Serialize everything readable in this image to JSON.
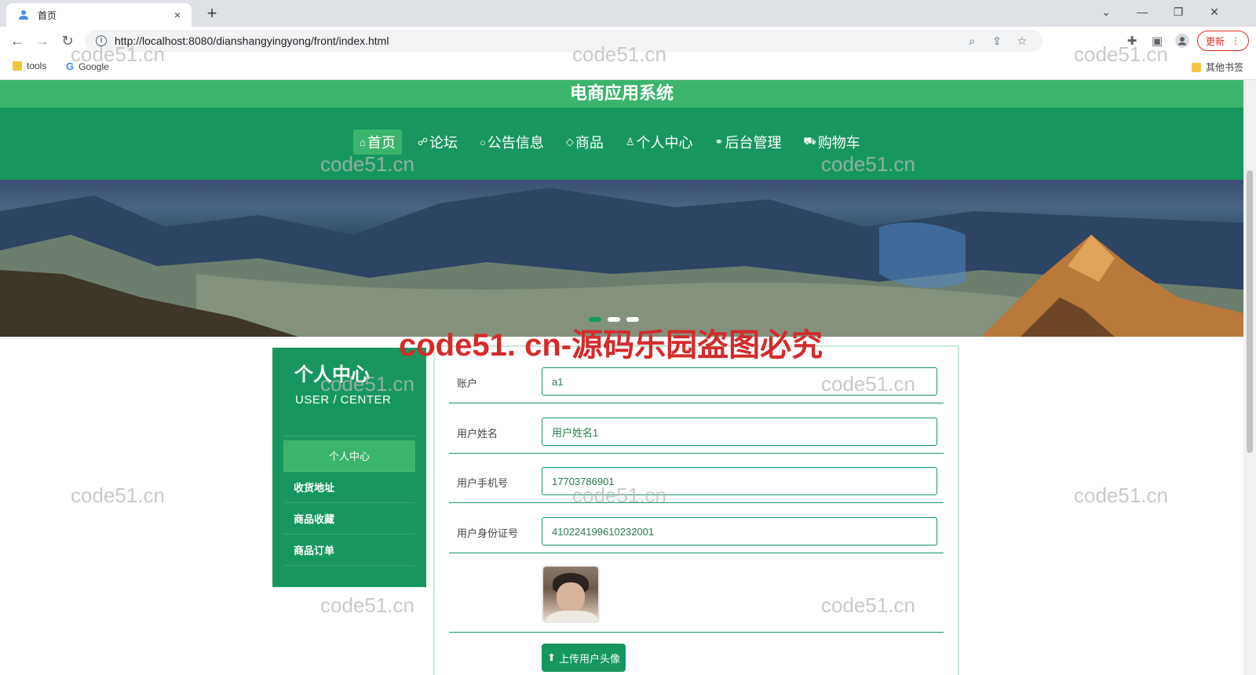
{
  "browser": {
    "tab_title": "首页",
    "tab_close": "×",
    "new_tab": "+",
    "url": "http://localhost:8080/dianshangyingyong/front/index.html",
    "update_label": "更新",
    "bookmarks": [
      {
        "label": "tools"
      },
      {
        "label": "Google"
      }
    ],
    "other_bookmarks": "其他书签"
  },
  "site": {
    "title": "电商应用系统",
    "nav": [
      {
        "icon": "⌂",
        "label": "首页",
        "active": true
      },
      {
        "icon": "☍",
        "label": "论坛"
      },
      {
        "icon": "○",
        "label": "公告信息"
      },
      {
        "icon": "◇",
        "label": "商品"
      },
      {
        "icon": "♙",
        "label": "个人中心"
      },
      {
        "icon": "⚭",
        "label": "后台管理"
      },
      {
        "icon": "⛟",
        "label": "购物车"
      }
    ]
  },
  "sidebar": {
    "title": "个人中心",
    "subtitle": "USER / CENTER",
    "items": [
      {
        "label": "个人中心",
        "active": true
      },
      {
        "label": "收货地址"
      },
      {
        "label": "商品收藏"
      },
      {
        "label": "商品订单"
      }
    ]
  },
  "form": {
    "fields": [
      {
        "label": "账户",
        "value": "a1"
      },
      {
        "label": "用户姓名",
        "value": "用户姓名1"
      },
      {
        "label": "用户手机号",
        "value": "17703786901"
      },
      {
        "label": "用户身份证号",
        "value": "410224199610232001"
      }
    ],
    "upload_label": "上传用户头像"
  },
  "watermarks": {
    "text": "code51.cn",
    "red_text": "code51. cn-源码乐园盗图必究"
  },
  "colors": {
    "primary": "#17975f",
    "accent": "#3db46d",
    "watermark_red": "#d42b2b"
  }
}
